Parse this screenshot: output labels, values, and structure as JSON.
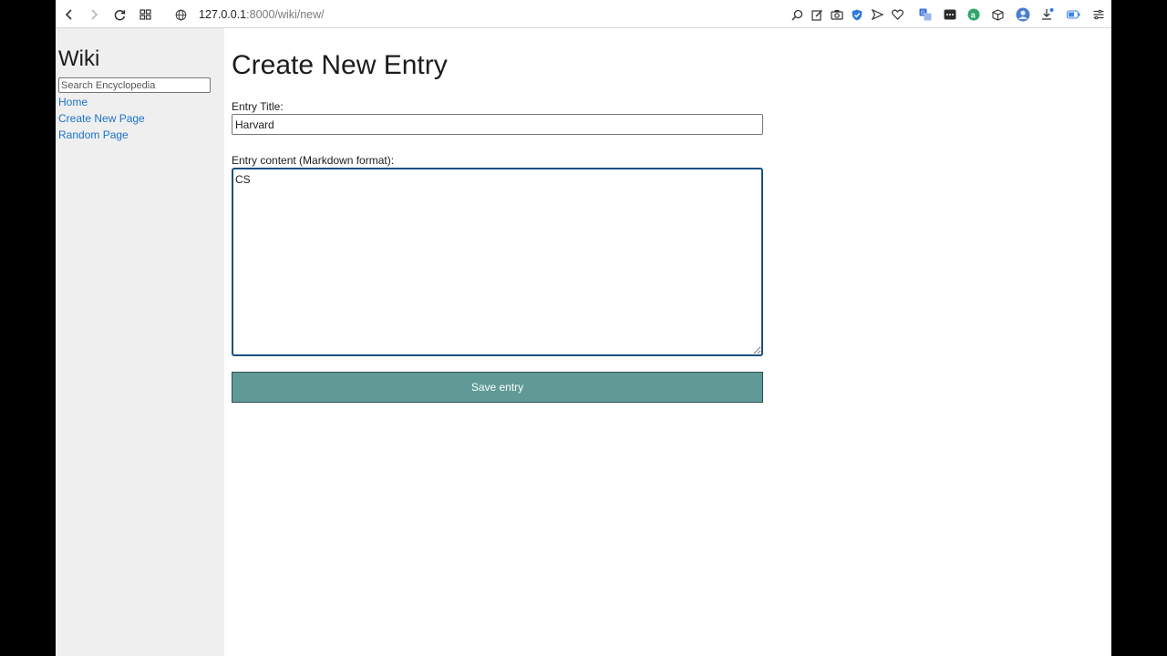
{
  "browser": {
    "url_host": "127.0.0.1",
    "url_path": ":8000/wiki/new/",
    "icons": {
      "back": "back-arrow-icon",
      "forward": "forward-arrow-icon",
      "reload": "reload-icon",
      "tabs": "tab-grid-icon",
      "site_info": "globe-icon",
      "extensions": [
        "zoom-icon",
        "edit-icon",
        "camera-icon",
        "shield-check-icon",
        "send-icon",
        "heart-icon",
        "translate-icon",
        "dots-icon",
        "a-icon",
        "cube-icon",
        "profile-icon",
        "download-icon",
        "battery-icon",
        "menu-icon"
      ]
    }
  },
  "sidebar": {
    "title": "Wiki",
    "search_placeholder": "Search Encyclopedia",
    "links": [
      "Home",
      "Create New Page",
      "Random Page"
    ]
  },
  "main": {
    "page_title": "Create New Entry",
    "title_label": "Entry Title:",
    "title_value": "Harvard",
    "content_label": "Entry content (Markdown format):",
    "content_value": "CS",
    "save_label": "Save entry"
  },
  "colors": {
    "link": "#1a73c8",
    "button_bg": "#5f9a96",
    "focus_border": "#1b4f82",
    "sidebar_bg": "#efefef"
  }
}
